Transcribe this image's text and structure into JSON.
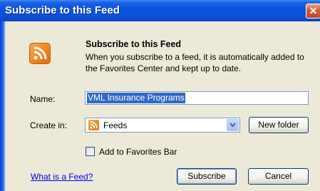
{
  "window": {
    "title": "Subscribe to this Feed",
    "close_glyph": "✕"
  },
  "header": {
    "heading": "Subscribe to this Feed",
    "description": "When you subscribe to a feed, it is automatically added to the Favorites Center and kept up to date.",
    "icon": "rss-feed-icon"
  },
  "form": {
    "name_label": "Name:",
    "name_value": "VML Insurance Programs",
    "create_in_label": "Create in:",
    "create_in_value": "Feeds",
    "new_folder_label": "New folder",
    "add_to_favorites_bar_label": "Add to Favorites Bar",
    "add_to_favorites_bar_checked": false
  },
  "footer": {
    "help_link": "What is a Feed?",
    "subscribe_label": "Subscribe",
    "cancel_label": "Cancel"
  },
  "colors": {
    "titlebar": "#0855dd",
    "dialog_bg": "#ece9d8",
    "accent_orange": "#f08a21",
    "selection": "#316ac5",
    "link": "#0000ff"
  }
}
